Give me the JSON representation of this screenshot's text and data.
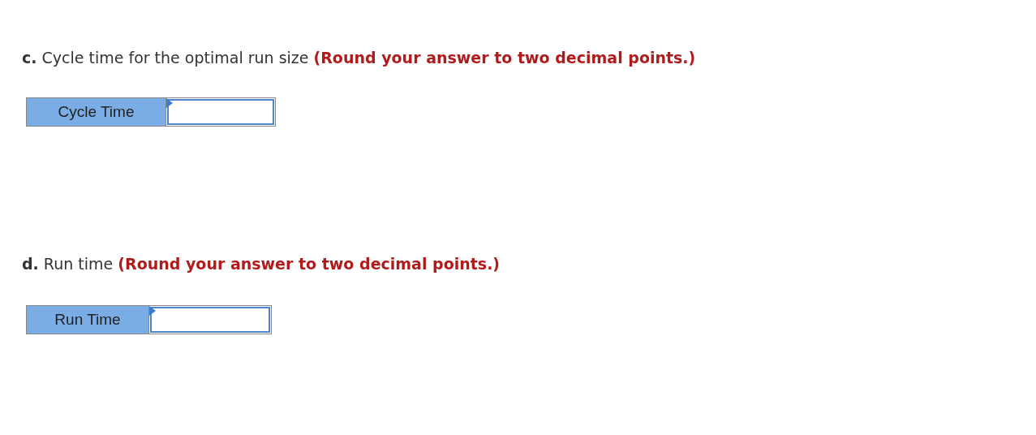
{
  "questions": [
    {
      "letter": "c.",
      "prompt": "Cycle time for the optimal run size",
      "instruction": "(Round your answer to two decimal points.)",
      "field_label": "Cycle Time"
    },
    {
      "letter": "d.",
      "prompt": "Run time",
      "instruction": "(Round your answer to two decimal points.)",
      "field_label": "Run Time"
    }
  ]
}
